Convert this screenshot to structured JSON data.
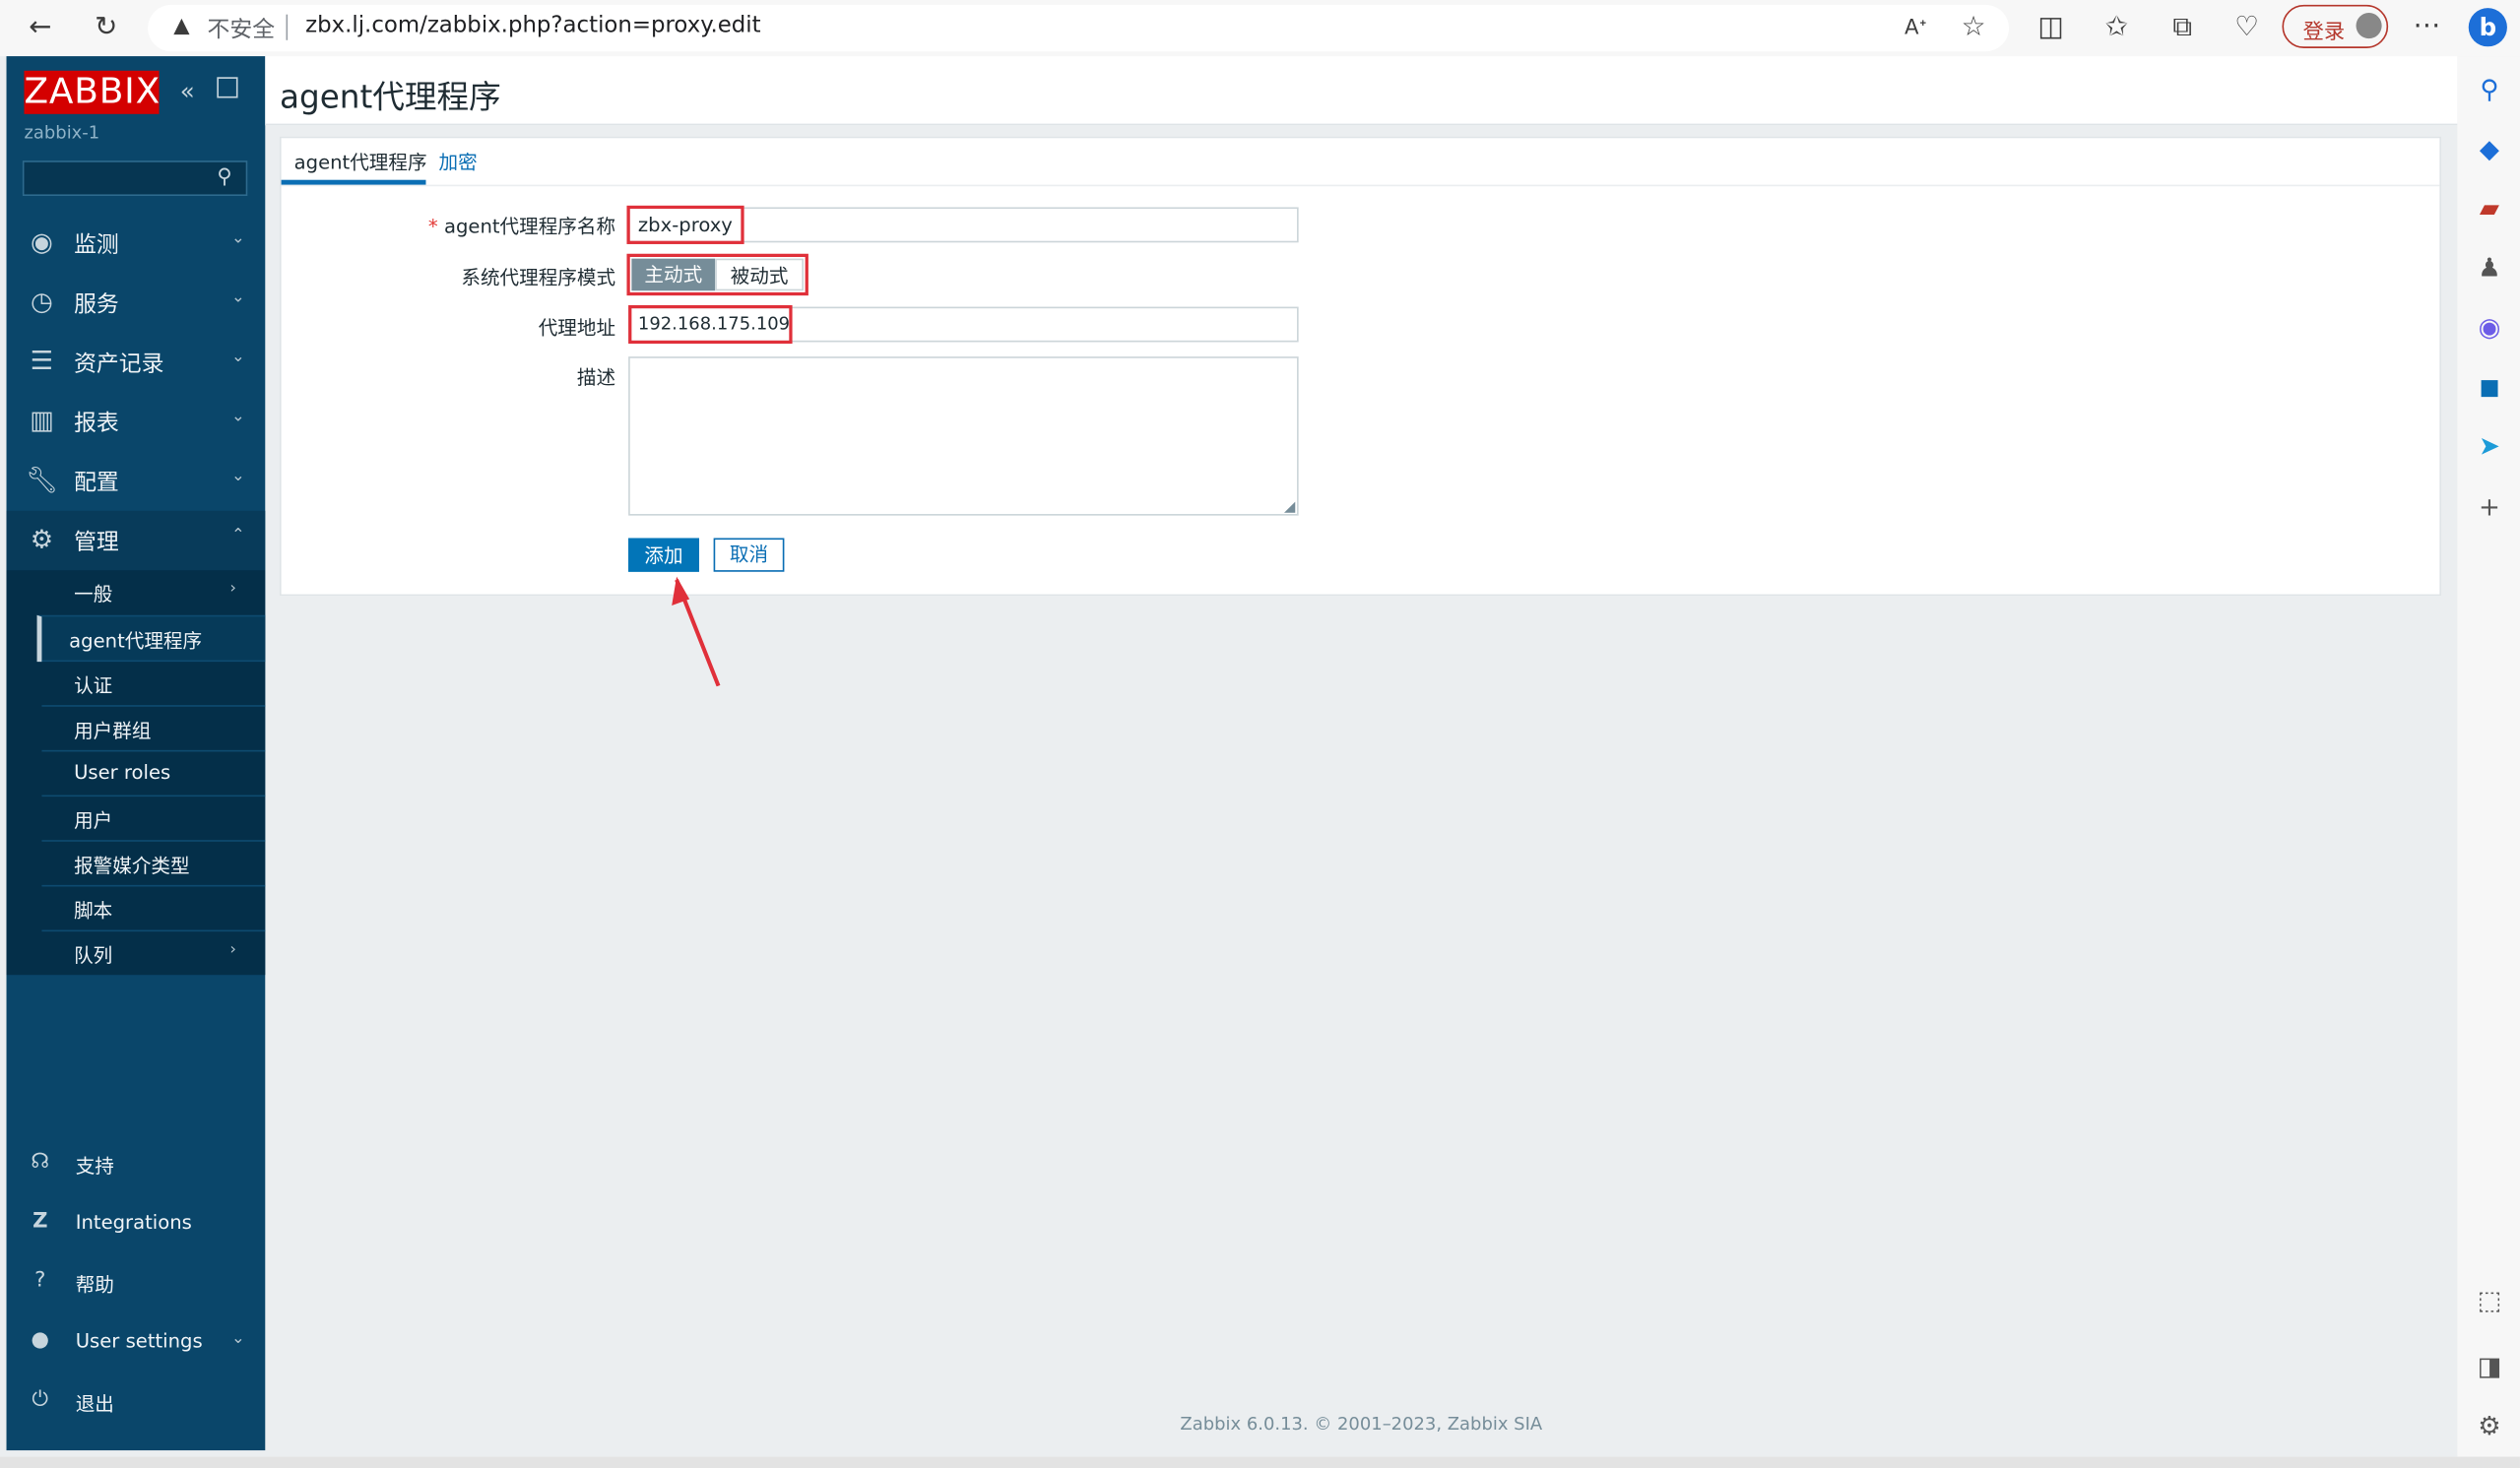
{
  "browser": {
    "security_label": "不安全",
    "url": "zbx.lj.com/zabbix.php?action=proxy.edit",
    "login_label": "登录"
  },
  "sidebar": {
    "logo": "ZABBIX",
    "host": "zabbix-1",
    "search_placeholder": "",
    "menu": [
      {
        "label": "监测",
        "icon": "eye-icon"
      },
      {
        "label": "服务",
        "icon": "clock-icon"
      },
      {
        "label": "资产记录",
        "icon": "list-icon"
      },
      {
        "label": "报表",
        "icon": "bar-chart-icon"
      },
      {
        "label": "配置",
        "icon": "wrench-icon"
      },
      {
        "label": "管理",
        "icon": "gear-icon"
      }
    ],
    "submenu": [
      "一般",
      "agent代理程序",
      "认证",
      "用户群组",
      "User roles",
      "用户",
      "报警媒介类型",
      "脚本",
      "队列"
    ],
    "bottom": [
      {
        "label": "支持",
        "icon": "headset-icon"
      },
      {
        "label": "Integrations",
        "icon": "zabbix-z-icon"
      },
      {
        "label": "帮助",
        "icon": "question-icon"
      },
      {
        "label": "User settings",
        "icon": "user-icon"
      },
      {
        "label": "退出",
        "icon": "power-icon"
      }
    ]
  },
  "page": {
    "title": "agent代理程序",
    "tabs": [
      "agent代理程序",
      "加密"
    ]
  },
  "form": {
    "name_label": "agent代理程序名称",
    "name_value": "zbx-proxy",
    "mode_label": "系统代理程序模式",
    "mode_options": [
      "主动式",
      "被动式"
    ],
    "mode_selected": "主动式",
    "address_label": "代理地址",
    "address_value": "192.168.175.109",
    "description_label": "描述",
    "description_value": "",
    "add_button": "添加",
    "cancel_button": "取消"
  },
  "footer": "Zabbix 6.0.13. © 2001–2023, Zabbix SIA",
  "colors": {
    "sidebar": "#0a466a",
    "accent": "#0275b8",
    "logo": "#d40000",
    "highlight": "#e0303a"
  }
}
